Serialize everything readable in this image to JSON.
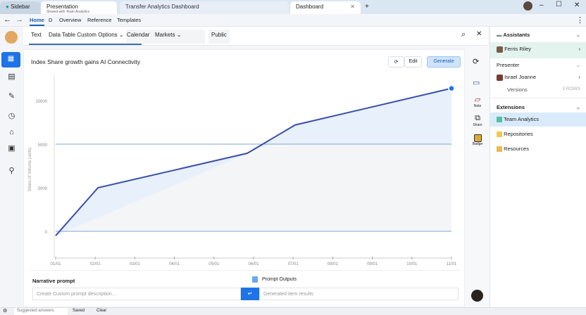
{
  "browser": {
    "tabs": [
      {
        "label": "Sidebar"
      },
      {
        "label": "Presentation"
      },
      {
        "label": "Transfer Analytics Dashboard"
      },
      {
        "label": "Dashboard"
      }
    ],
    "tab_subtitle": "Shared with Team Analytics",
    "new_tab": "+",
    "window_controls": {
      "minimize": "–",
      "maximize": "☐",
      "close": "✕"
    }
  },
  "nav": {
    "tabs": [
      "Home",
      "D",
      "Overview",
      "Reference",
      "Templates"
    ]
  },
  "toolbar": {
    "items": [
      "Text",
      "Data Table Custom Options",
      "Calendar",
      "Markets",
      "Public"
    ]
  },
  "card": {
    "title": "Index Share growth gains AI Connectivity",
    "refresh_label": "⟳",
    "edit_label": "Edit",
    "primary_label": "Generate"
  },
  "chart_data": {
    "type": "line",
    "title": "Index Share growth gains AI Connectivity",
    "ylabel": "Share of Volume (units)",
    "y_tick_labels": [
      "0",
      "3000",
      "5000",
      "10000"
    ],
    "y_ticks": [
      0,
      1,
      2,
      3
    ],
    "ylim": [
      -0.6,
      3.6
    ],
    "x_tick_labels": [
      "01/01",
      "02/01",
      "03/01",
      "04/01",
      "05/01",
      "06/01",
      "07/01",
      "08/01",
      "09/01",
      "10/01",
      "11/01"
    ],
    "series": [
      {
        "name": "Share",
        "x": [
          0,
          1.07,
          4.84,
          6.05,
          10
        ],
        "y": [
          -0.1,
          1,
          1.79,
          2.44,
          3.28
        ],
        "color": "#3a50a8"
      }
    ],
    "reference_lines": [
      0,
      2
    ]
  },
  "footer": {
    "left_label": "Narrative prompt",
    "input_placeholder": "Create Custom prompt description…",
    "send_icon": "↵",
    "right_label": "Prompt Outputs",
    "output_placeholder": "Generated item results"
  },
  "right_icons": [
    "Sync",
    "Slide",
    "Note",
    "Share",
    "Badge"
  ],
  "right_panel": {
    "header": "Assistants",
    "items": [
      {
        "label": "Ferris Riley",
        "active": true
      },
      {
        "label": "Presenter"
      },
      {
        "label": "Israel Joanne"
      },
      {
        "label": "Versions",
        "meta": "3 ROWS"
      }
    ],
    "section": "Extensions",
    "ext": [
      {
        "label": "Team Analytics",
        "color": "#4fc3a1",
        "active": true
      },
      {
        "label": "Repositories",
        "color": "#f2c94c"
      },
      {
        "label": "Resources",
        "color": "#f2b84c"
      }
    ]
  },
  "bottom": {
    "items": [
      "⚙",
      "Suggested answers",
      "Saved",
      "Clear"
    ]
  }
}
